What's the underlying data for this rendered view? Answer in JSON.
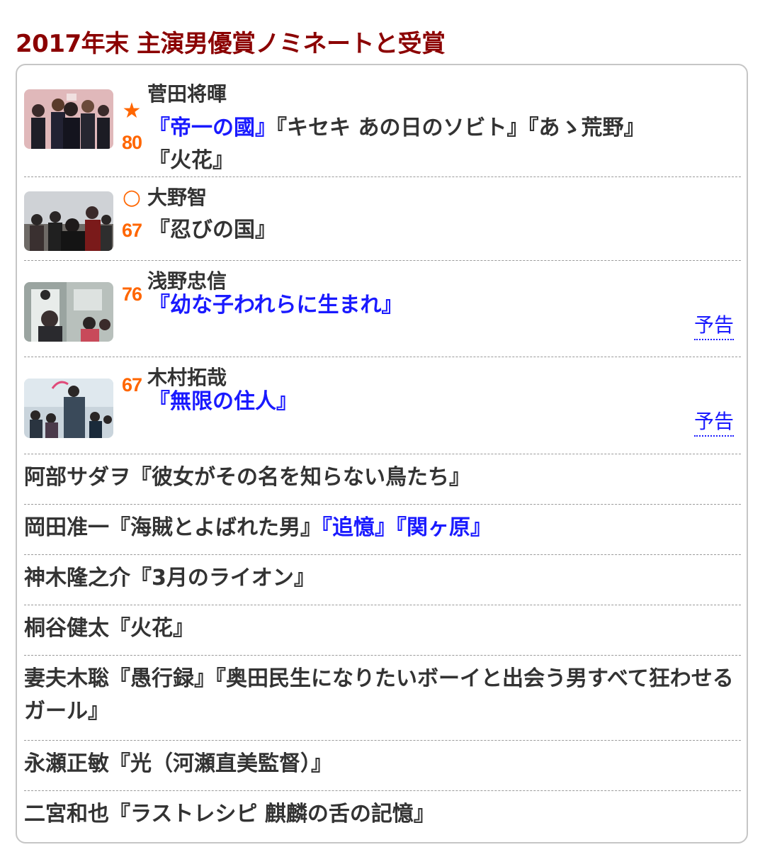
{
  "title": "2017年末 主演男優賞ノミネートと受賞",
  "featured": [
    {
      "actor": "菅田将暉",
      "mark": "★",
      "score": "80",
      "films": [
        {
          "text": "『帝一の國』",
          "link": true
        },
        {
          "text": "『キセキ あの日のソビト』",
          "link": false
        },
        {
          "text": "『あゝ荒野』",
          "link": false
        },
        {
          "text": "『火花』",
          "link": false
        }
      ],
      "trailer": ""
    },
    {
      "actor": "大野智",
      "mark": "○",
      "score": "67",
      "films": [
        {
          "text": "『忍びの国』",
          "link": false
        }
      ],
      "trailer": ""
    },
    {
      "actor": "浅野忠信",
      "mark": "",
      "score": "76",
      "films": [
        {
          "text": "『幼な子われらに生まれ』",
          "link": true
        }
      ],
      "trailer": "予告"
    },
    {
      "actor": "木村拓哉",
      "mark": "",
      "score": "67",
      "films": [
        {
          "text": "『無限の住人』",
          "link": true
        }
      ],
      "trailer": "予告"
    }
  ],
  "others": [
    {
      "actor": "阿部サダヲ",
      "films": [
        {
          "text": "『彼女がその名を知らない鳥たち』",
          "link": false
        }
      ]
    },
    {
      "actor": "岡田准一",
      "films": [
        {
          "text": "『海賊とよばれた男』",
          "link": false
        },
        {
          "text": "『追憶』",
          "link": true
        },
        {
          "text": "『関ヶ原』",
          "link": true
        }
      ]
    },
    {
      "actor": "神木隆之介",
      "films": [
        {
          "text": "『3月のライオン』",
          "link": false
        }
      ]
    },
    {
      "actor": "桐谷健太",
      "films": [
        {
          "text": "『火花』",
          "link": false
        }
      ]
    },
    {
      "actor": "妻夫木聡",
      "films": [
        {
          "text": "『愚行録』",
          "link": false
        },
        {
          "text": "『奥田民生になりたいボーイと出会う男すべて狂わせるガール』",
          "link": false
        }
      ]
    },
    {
      "actor": "永瀬正敏",
      "films": [
        {
          "text": "『光（河瀬直美監督）』",
          "link": false
        }
      ]
    },
    {
      "actor": "二宮和也",
      "films": [
        {
          "text": "『ラストレシピ 麒麟の舌の記憶』",
          "link": false
        }
      ]
    }
  ],
  "colors": {
    "title": "#8b0000",
    "score": "#ff6600",
    "link": "#1a1aff",
    "text": "#333333"
  }
}
